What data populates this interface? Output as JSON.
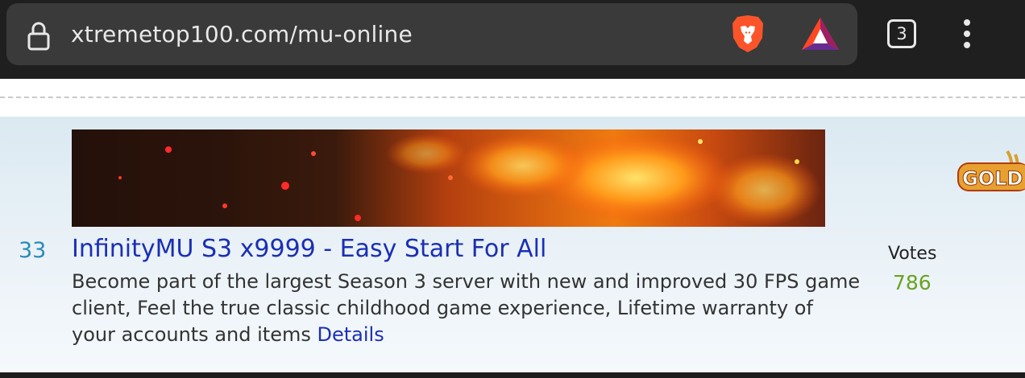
{
  "browser": {
    "url": "xtremetop100.com/mu-online",
    "tab_count": "3",
    "icons": [
      "lock-icon",
      "brave-lion-icon",
      "bat-rewards-icon",
      "tabs-icon",
      "more-menu-icon"
    ]
  },
  "listing": {
    "rank": "33",
    "title": "InfinityMU S3 x9999 - Easy Start For All",
    "description": "Become part of the largest Season 3 server with new and improved 30 FPS game client, Feel the true classic childhood game experience, Lifetime warranty of your accounts and items",
    "details_link": "Details",
    "votes_label": "Votes",
    "votes_count": "786",
    "badge_text": "GOLD"
  },
  "colors": {
    "link": "#1a2fb5",
    "rank": "#2a8ab8",
    "votes": "#6aa321",
    "chrome_bg": "#1f1f1f",
    "url_box": "#3a3a3a"
  }
}
